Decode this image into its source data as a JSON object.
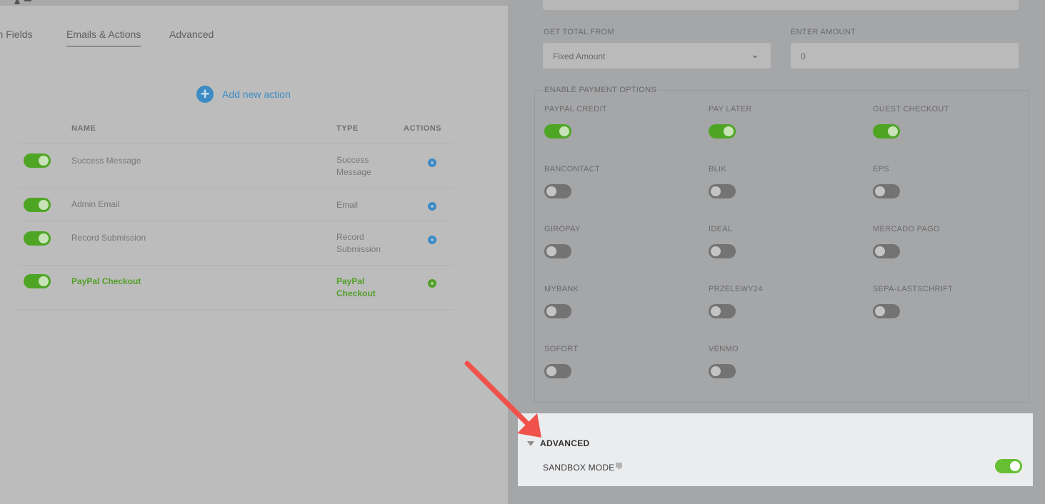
{
  "tabs": [
    {
      "label": "rm Fields"
    },
    {
      "label": "Emails & Actions"
    },
    {
      "label": "Advanced"
    }
  ],
  "add_action": {
    "label": "Add new action"
  },
  "table": {
    "columns": [
      "NAME",
      "TYPE",
      "ACTIONS"
    ],
    "rows": [
      {
        "name": "Success Message",
        "type": "Success Message",
        "enabled": true
      },
      {
        "name": "Admin Email",
        "type": "Email",
        "enabled": true
      },
      {
        "name": "Record Submission",
        "type": "Record Submission",
        "enabled": true
      },
      {
        "name": "PayPal Checkout",
        "type": "PayPal Checkout",
        "enabled": true,
        "highlight_color": "#52a028"
      }
    ]
  },
  "payment": {
    "total_from_label": "GET TOTAL FROM",
    "total_from_value": "Fixed Amount",
    "amount_label": "ENTER AMOUNT",
    "amount_value": "0",
    "options_legend": "ENABLE PAYMENT OPTIONS",
    "options": [
      {
        "label": "PAYPAL CREDIT",
        "enabled": true
      },
      {
        "label": "PAY LATER",
        "enabled": true
      },
      {
        "label": "GUEST CHECKOUT",
        "enabled": true
      },
      {
        "label": "BANCONTACT",
        "enabled": false
      },
      {
        "label": "BLIK",
        "enabled": false
      },
      {
        "label": "EPS",
        "enabled": false
      },
      {
        "label": "GIROPAY",
        "enabled": false
      },
      {
        "label": "IDEAL",
        "enabled": false
      },
      {
        "label": "MERCADO PAGO",
        "enabled": false
      },
      {
        "label": "MYBANK",
        "enabled": false
      },
      {
        "label": "PRZELEWY24",
        "enabled": false
      },
      {
        "label": "SEPA-LASTSCHRIFT",
        "enabled": false
      },
      {
        "label": "SOFORT",
        "enabled": false
      },
      {
        "label": "VENMO",
        "enabled": false
      }
    ]
  },
  "advanced": {
    "title": "ADVANCED",
    "sandbox_label": "SANDBOX MODE",
    "sandbox_enabled": true
  },
  "colors": {
    "accent_blue": "#3d8bc4",
    "toggle_on": "#67bf34",
    "annotation_arrow": "#f0524b"
  }
}
